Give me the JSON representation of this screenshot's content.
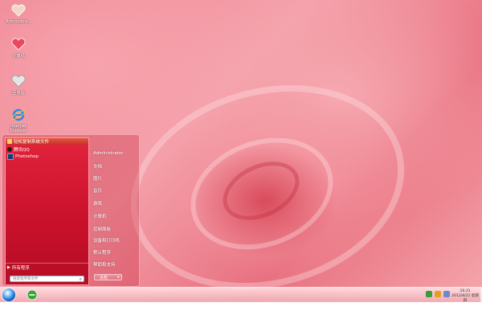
{
  "desktop": {
    "icons": [
      {
        "label": "Administra..."
      },
      {
        "label": "计算机"
      },
      {
        "label": "回收站"
      },
      {
        "label": "Internet Explorer"
      }
    ]
  },
  "start_menu": {
    "recent_header": "轻松复制系统文件",
    "programs": [
      {
        "label": "腾讯QQ"
      },
      {
        "label": "Photoshop"
      }
    ],
    "all_programs": "所有程序",
    "search_placeholder": "搜索程序和文件",
    "right_links": [
      "Administrator",
      "文档",
      "图片",
      "音乐",
      "游戏",
      "计算机",
      "控制面板",
      "设备和打印机",
      "默认程序",
      "帮助和支持"
    ],
    "shutdown_label": "关机"
  },
  "taskbar": {
    "clock_time": "16:31",
    "clock_date": "2012/8/22 星期四"
  },
  "colors": {
    "accent": "#c8102b",
    "taskbar": "#f4c3c8"
  }
}
